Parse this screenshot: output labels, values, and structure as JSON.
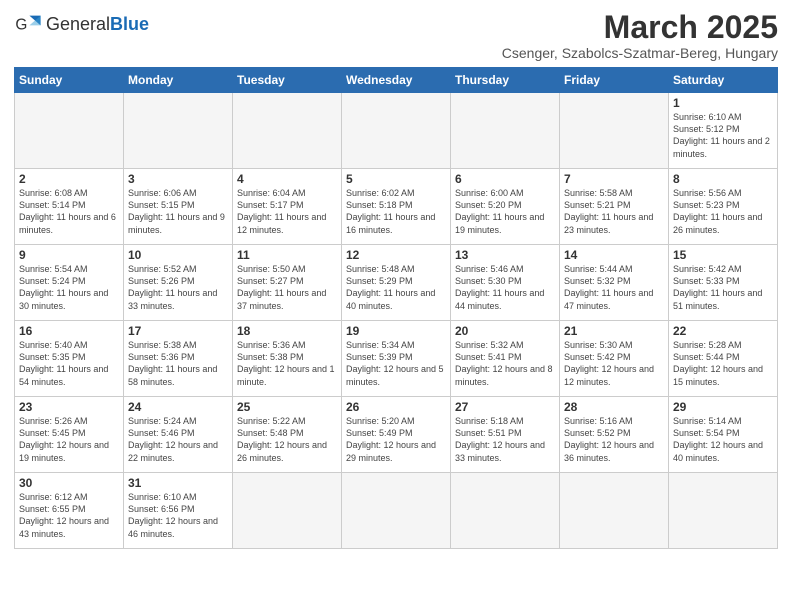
{
  "header": {
    "logo_general": "General",
    "logo_blue": "Blue",
    "month_title": "March 2025",
    "location": "Csenger, Szabolcs-Szatmar-Bereg, Hungary"
  },
  "days_of_week": [
    "Sunday",
    "Monday",
    "Tuesday",
    "Wednesday",
    "Thursday",
    "Friday",
    "Saturday"
  ],
  "weeks": [
    [
      {
        "day": "",
        "info": ""
      },
      {
        "day": "",
        "info": ""
      },
      {
        "day": "",
        "info": ""
      },
      {
        "day": "",
        "info": ""
      },
      {
        "day": "",
        "info": ""
      },
      {
        "day": "",
        "info": ""
      },
      {
        "day": "1",
        "info": "Sunrise: 6:10 AM\nSunset: 5:12 PM\nDaylight: 11 hours and 2 minutes."
      }
    ],
    [
      {
        "day": "2",
        "info": "Sunrise: 6:08 AM\nSunset: 5:14 PM\nDaylight: 11 hours and 6 minutes."
      },
      {
        "day": "3",
        "info": "Sunrise: 6:06 AM\nSunset: 5:15 PM\nDaylight: 11 hours and 9 minutes."
      },
      {
        "day": "4",
        "info": "Sunrise: 6:04 AM\nSunset: 5:17 PM\nDaylight: 11 hours and 12 minutes."
      },
      {
        "day": "5",
        "info": "Sunrise: 6:02 AM\nSunset: 5:18 PM\nDaylight: 11 hours and 16 minutes."
      },
      {
        "day": "6",
        "info": "Sunrise: 6:00 AM\nSunset: 5:20 PM\nDaylight: 11 hours and 19 minutes."
      },
      {
        "day": "7",
        "info": "Sunrise: 5:58 AM\nSunset: 5:21 PM\nDaylight: 11 hours and 23 minutes."
      },
      {
        "day": "8",
        "info": "Sunrise: 5:56 AM\nSunset: 5:23 PM\nDaylight: 11 hours and 26 minutes."
      }
    ],
    [
      {
        "day": "9",
        "info": "Sunrise: 5:54 AM\nSunset: 5:24 PM\nDaylight: 11 hours and 30 minutes."
      },
      {
        "day": "10",
        "info": "Sunrise: 5:52 AM\nSunset: 5:26 PM\nDaylight: 11 hours and 33 minutes."
      },
      {
        "day": "11",
        "info": "Sunrise: 5:50 AM\nSunset: 5:27 PM\nDaylight: 11 hours and 37 minutes."
      },
      {
        "day": "12",
        "info": "Sunrise: 5:48 AM\nSunset: 5:29 PM\nDaylight: 11 hours and 40 minutes."
      },
      {
        "day": "13",
        "info": "Sunrise: 5:46 AM\nSunset: 5:30 PM\nDaylight: 11 hours and 44 minutes."
      },
      {
        "day": "14",
        "info": "Sunrise: 5:44 AM\nSunset: 5:32 PM\nDaylight: 11 hours and 47 minutes."
      },
      {
        "day": "15",
        "info": "Sunrise: 5:42 AM\nSunset: 5:33 PM\nDaylight: 11 hours and 51 minutes."
      }
    ],
    [
      {
        "day": "16",
        "info": "Sunrise: 5:40 AM\nSunset: 5:35 PM\nDaylight: 11 hours and 54 minutes."
      },
      {
        "day": "17",
        "info": "Sunrise: 5:38 AM\nSunset: 5:36 PM\nDaylight: 11 hours and 58 minutes."
      },
      {
        "day": "18",
        "info": "Sunrise: 5:36 AM\nSunset: 5:38 PM\nDaylight: 12 hours and 1 minute."
      },
      {
        "day": "19",
        "info": "Sunrise: 5:34 AM\nSunset: 5:39 PM\nDaylight: 12 hours and 5 minutes."
      },
      {
        "day": "20",
        "info": "Sunrise: 5:32 AM\nSunset: 5:41 PM\nDaylight: 12 hours and 8 minutes."
      },
      {
        "day": "21",
        "info": "Sunrise: 5:30 AM\nSunset: 5:42 PM\nDaylight: 12 hours and 12 minutes."
      },
      {
        "day": "22",
        "info": "Sunrise: 5:28 AM\nSunset: 5:44 PM\nDaylight: 12 hours and 15 minutes."
      }
    ],
    [
      {
        "day": "23",
        "info": "Sunrise: 5:26 AM\nSunset: 5:45 PM\nDaylight: 12 hours and 19 minutes."
      },
      {
        "day": "24",
        "info": "Sunrise: 5:24 AM\nSunset: 5:46 PM\nDaylight: 12 hours and 22 minutes."
      },
      {
        "day": "25",
        "info": "Sunrise: 5:22 AM\nSunset: 5:48 PM\nDaylight: 12 hours and 26 minutes."
      },
      {
        "day": "26",
        "info": "Sunrise: 5:20 AM\nSunset: 5:49 PM\nDaylight: 12 hours and 29 minutes."
      },
      {
        "day": "27",
        "info": "Sunrise: 5:18 AM\nSunset: 5:51 PM\nDaylight: 12 hours and 33 minutes."
      },
      {
        "day": "28",
        "info": "Sunrise: 5:16 AM\nSunset: 5:52 PM\nDaylight: 12 hours and 36 minutes."
      },
      {
        "day": "29",
        "info": "Sunrise: 5:14 AM\nSunset: 5:54 PM\nDaylight: 12 hours and 40 minutes."
      }
    ],
    [
      {
        "day": "30",
        "info": "Sunrise: 6:12 AM\nSunset: 6:55 PM\nDaylight: 12 hours and 43 minutes."
      },
      {
        "day": "31",
        "info": "Sunrise: 6:10 AM\nSunset: 6:56 PM\nDaylight: 12 hours and 46 minutes."
      },
      {
        "day": "",
        "info": ""
      },
      {
        "day": "",
        "info": ""
      },
      {
        "day": "",
        "info": ""
      },
      {
        "day": "",
        "info": ""
      },
      {
        "day": "",
        "info": ""
      }
    ]
  ]
}
